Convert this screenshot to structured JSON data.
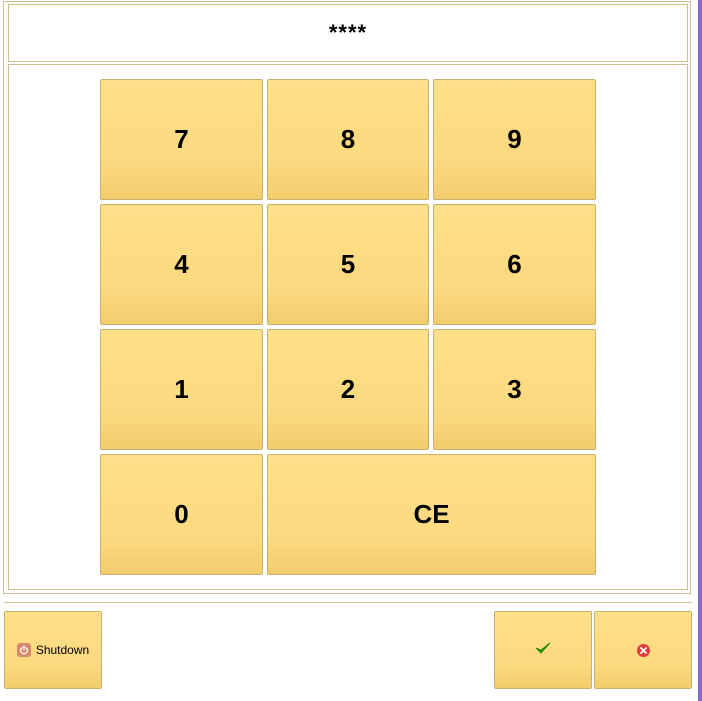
{
  "display": {
    "value": "****"
  },
  "keypad": {
    "k7": "7",
    "k8": "8",
    "k9": "9",
    "k4": "4",
    "k5": "5",
    "k6": "6",
    "k1": "1",
    "k2": "2",
    "k3": "3",
    "k0": "0",
    "clear": "CE"
  },
  "footer": {
    "shutdown_label": "Shutdown",
    "shutdown_icon": "power-icon",
    "ok_icon": "checkmark-icon",
    "cancel_icon": "close-icon"
  },
  "colors": {
    "key_fill": "#fbd97f",
    "key_border": "#c9b26f",
    "panel_border": "#cdbf8f",
    "accent_bar": "#8c6bd0",
    "ok_green": "#2ea800",
    "cancel_red": "#e23b3b"
  }
}
